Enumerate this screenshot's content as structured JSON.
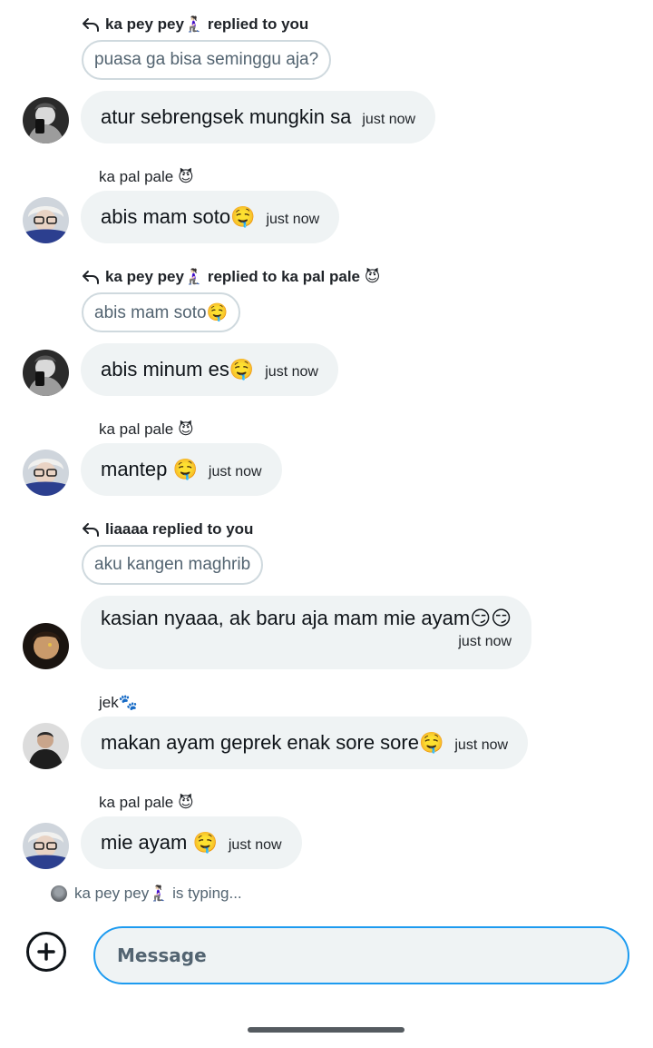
{
  "messages": [
    {
      "reply_label": "ka pey pey🧎🏻‍♀️ replied to you",
      "quoted": "puasa ga bisa seminggu aja?",
      "text": "atur sebrengsek mungkin sa",
      "time": "just now"
    },
    {
      "sender": "ka pal pale 😈",
      "text": "abis mam soto🤤",
      "time": "just now"
    },
    {
      "reply_label": "ka pey pey🧎🏻‍♀️ replied to ka pal pale 😈",
      "quoted": "abis mam soto🤤",
      "text": "abis minum es🤤",
      "time": "just now"
    },
    {
      "sender": "ka pal pale 😈",
      "text": "mantep 🤤",
      "time": "just now"
    },
    {
      "reply_label": "liaaaa replied to you",
      "quoted": "aku kangen maghrib",
      "text": "kasian nyaaa, ak baru aja mam mie ayam😏😏",
      "time": "just now"
    },
    {
      "sender": "jek🐾",
      "text": "makan ayam geprek enak sore sore🤤",
      "time": "just now"
    },
    {
      "sender": "ka pal pale 😈",
      "text": "mie ayam 🤤",
      "time": "just now"
    }
  ],
  "typing_indicator": "ka pey pey🧎🏻‍♀️ is typing...",
  "composer": {
    "placeholder": "Message",
    "add_icon": "plus-circle-icon",
    "value": ""
  },
  "colors": {
    "bubble": "#eff3f4",
    "input_border": "#1d9bf0",
    "secondary_text": "#536471"
  }
}
